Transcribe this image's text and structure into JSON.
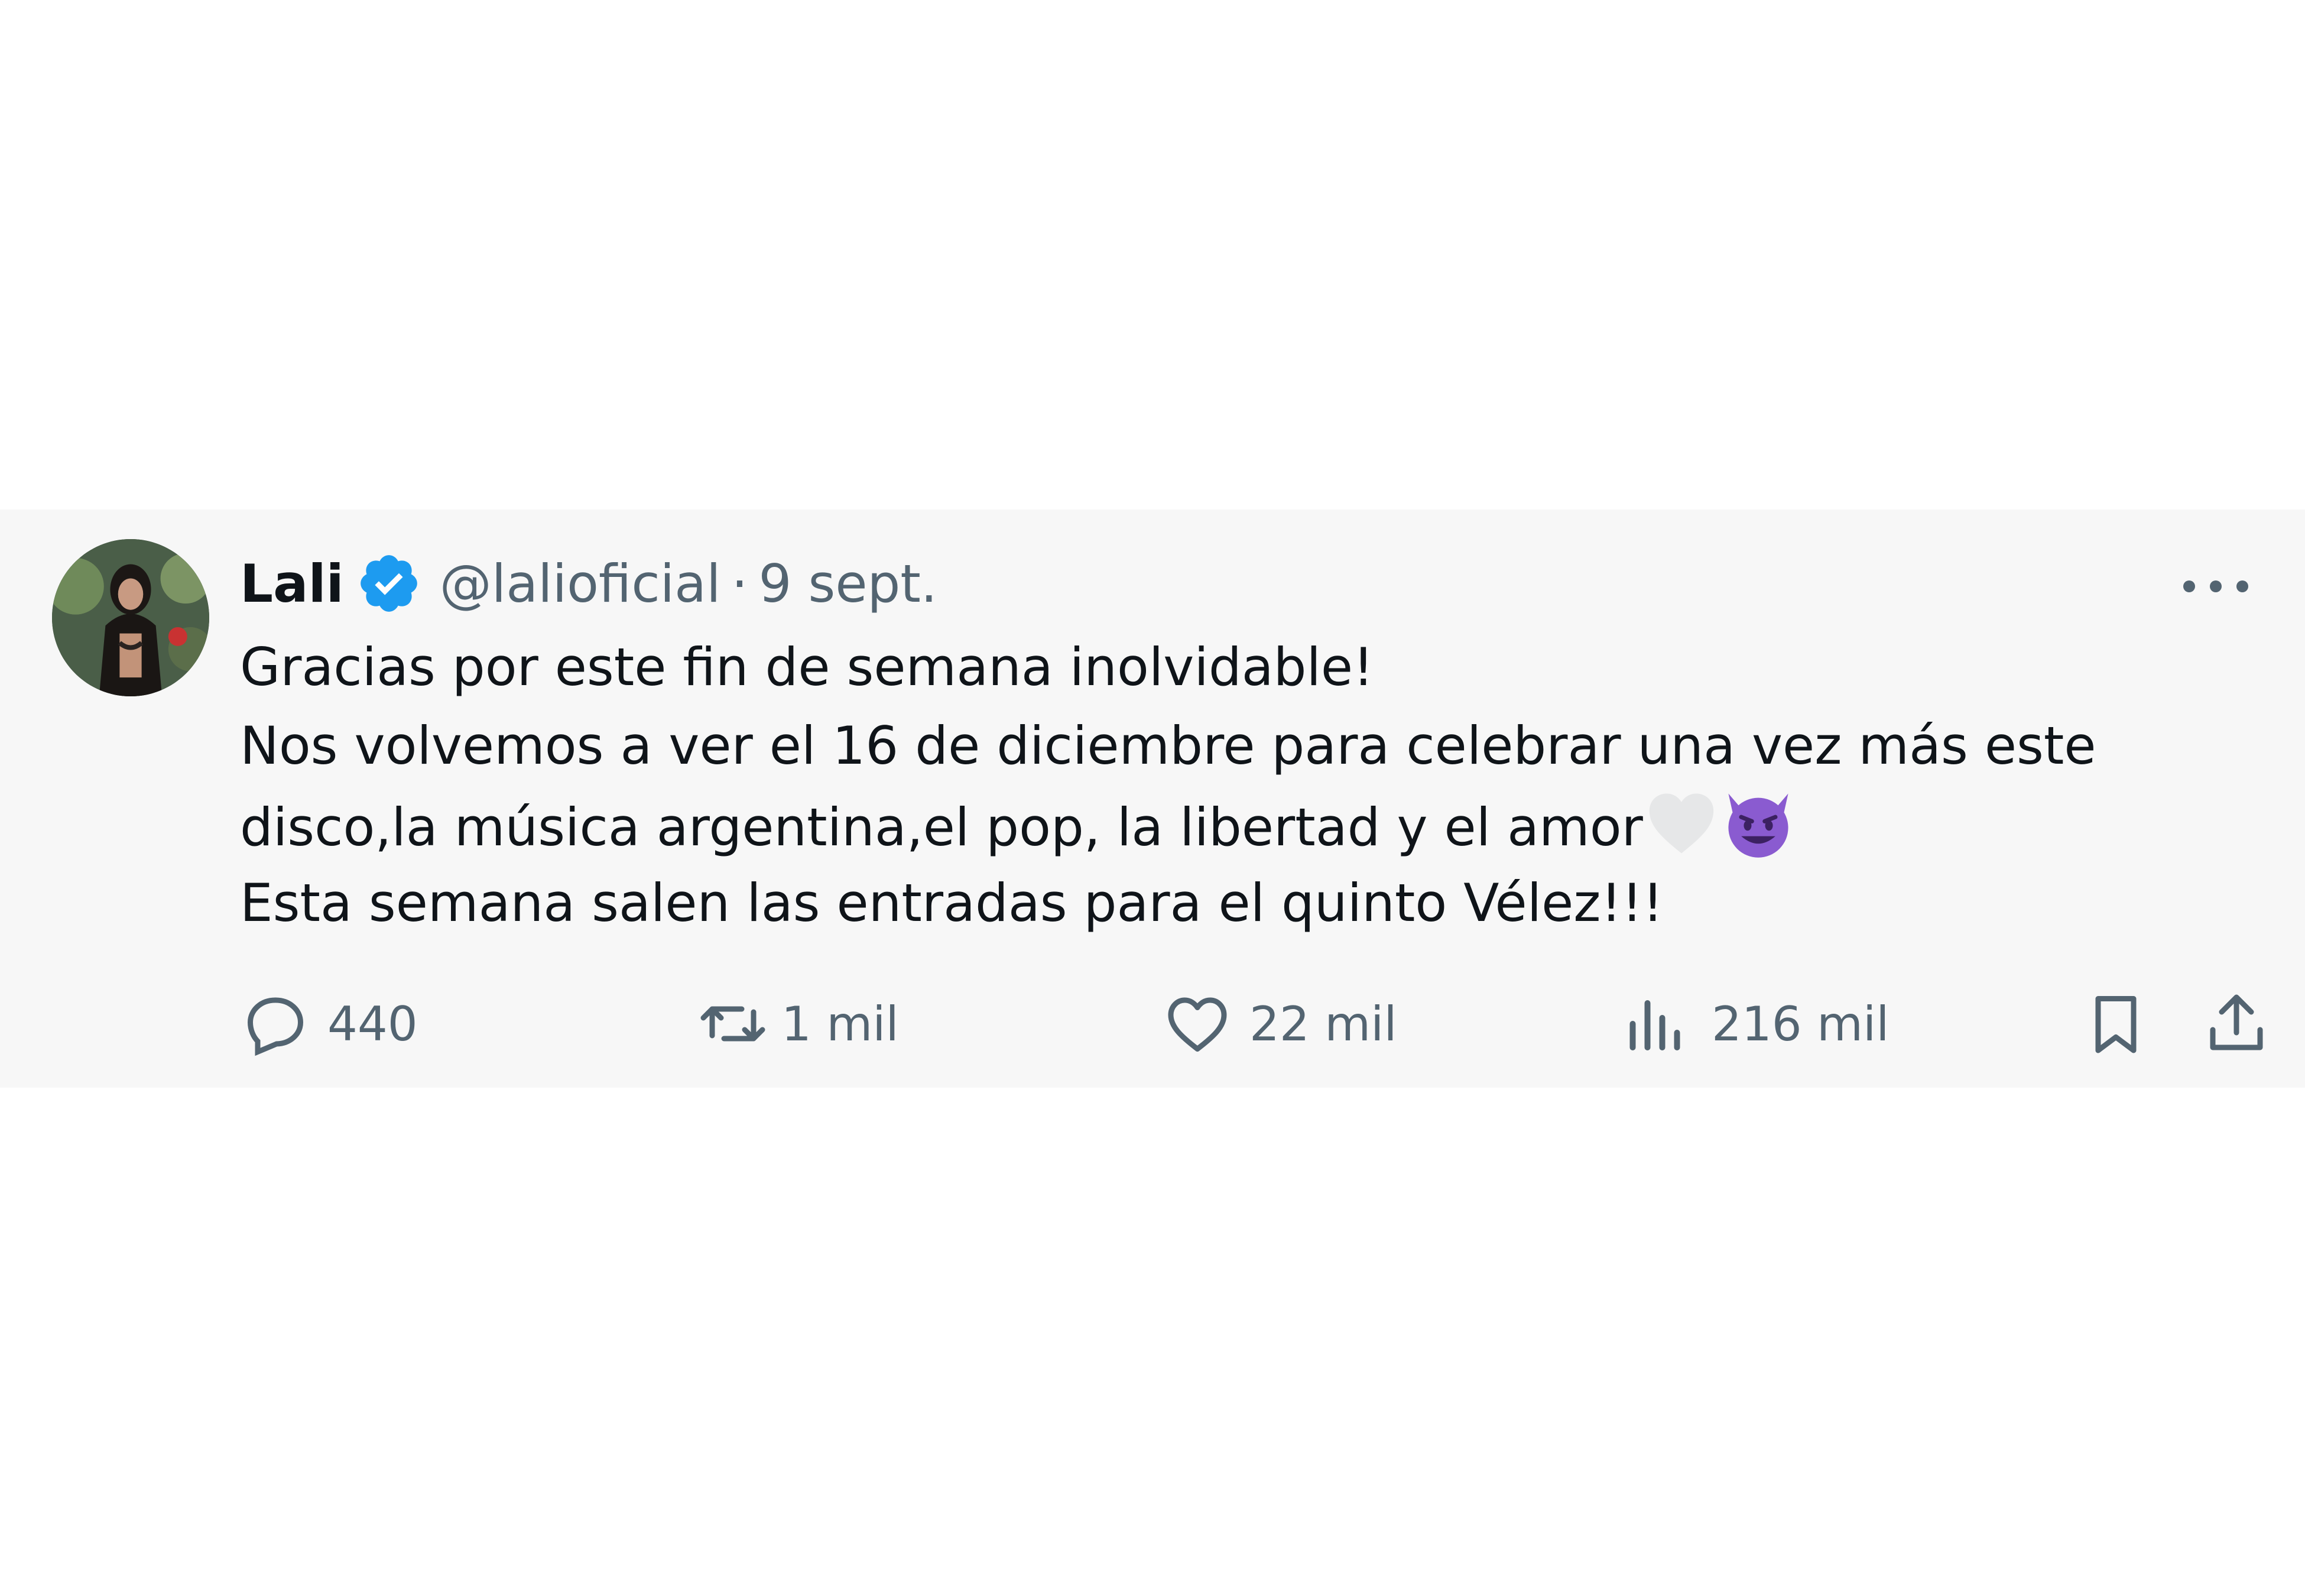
{
  "tweet": {
    "author_name": "Lali",
    "handle": "@lalioficial",
    "separator": "·",
    "date": "9 sept.",
    "text_lines": [
      "Gracias por este fin de semana inolvidable!",
      "Nos volvemos a ver el 16 de diciembre para celebrar una vez más este",
      "disco,la música argentina,el pop, la libertad y el amor",
      "Esta semana salen las entradas para el quinto Vélez!!!"
    ],
    "emojis": [
      "white-heart",
      "smiling-devil"
    ],
    "actions": {
      "replies": "440",
      "reposts": "1 mil",
      "likes": "22 mil",
      "views": "216 mil"
    }
  },
  "colors": {
    "card_background": "#f7f7f7",
    "text_primary": "#0f1419",
    "text_secondary": "#536471",
    "verified_blue": "#1d9bf0",
    "devil_purple": "#8a5bd0"
  },
  "icons": [
    "verified-badge-icon",
    "more-icon",
    "reply-icon",
    "repost-icon",
    "like-icon",
    "views-icon",
    "bookmark-icon",
    "share-icon"
  ]
}
